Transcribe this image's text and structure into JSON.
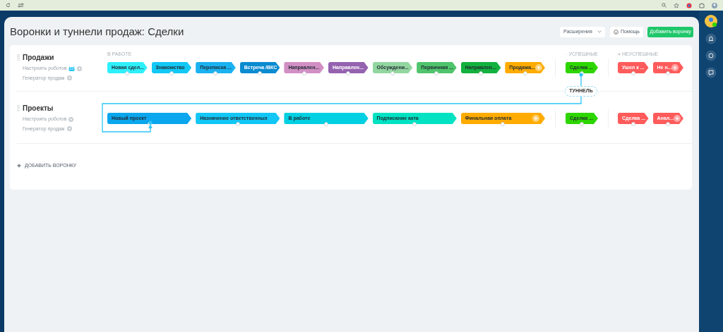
{
  "page_title": "Воронки и туннели продаж: Сделки",
  "header_buttons": {
    "extensions": "Расширения",
    "help": "Помощь",
    "add": "Добавить воронку"
  },
  "column_headers": {
    "in_work": "В РАБОТЕ",
    "success": "УСПЕШНЫЕ",
    "fail": "НЕУСПЕШНЫЕ"
  },
  "funnels": [
    {
      "name": "Продажи",
      "links": [
        {
          "label": "Настроить роботов",
          "robot_icon": true
        },
        {
          "label": "Генератор продаж",
          "robot_icon": false
        }
      ],
      "stages": [
        {
          "name": "Новая сдел...",
          "color": "#2ef0fa",
          "light_text": false,
          "add": false
        },
        {
          "name": "Знакомство",
          "color": "#12c8f5",
          "light_text": false,
          "add": false
        },
        {
          "name": "Переписка ...",
          "color": "#1ab2f0",
          "light_text": false,
          "add": false
        },
        {
          "name": "Встреча /ВКС",
          "color": "#0b8bd0",
          "light_text": true,
          "add": false
        },
        {
          "name": "Направлен...",
          "color": "#d18fc4",
          "light_text": false,
          "add": false
        },
        {
          "name": "Направлен...",
          "color": "#9562b0",
          "light_text": true,
          "add": false
        },
        {
          "name": "Обсуждени...",
          "color": "#93d6a0",
          "light_text": false,
          "add": false
        },
        {
          "name": "Первичная ...",
          "color": "#4fc46c",
          "light_text": false,
          "add": false
        },
        {
          "name": "Направлен...",
          "color": "#13b13e",
          "light_text": false,
          "add": false
        },
        {
          "name": "Продажа...",
          "color": "#ffab00",
          "light_text": false,
          "add": true
        }
      ],
      "success": [
        {
          "name": "Сделка ...",
          "color": "#2ed600",
          "light_text": false,
          "add": false
        }
      ],
      "fail": [
        {
          "name": "Ушел к ...",
          "color": "#ff5b5b",
          "light_text": true,
          "add": false
        },
        {
          "name": "Не н...",
          "color": "#ff5b5b",
          "light_text": true,
          "add": true
        }
      ]
    },
    {
      "name": "Проекты",
      "links": [
        {
          "label": "Настроить роботов",
          "robot_icon": false
        },
        {
          "label": "Генератор продаж",
          "robot_icon": false
        }
      ],
      "stages": [
        {
          "name": "Новый проект",
          "color": "#0aa6ee",
          "light_text": false,
          "add": false
        },
        {
          "name": "Назначение ответственных",
          "color": "#12c6f5",
          "light_text": false,
          "add": false
        },
        {
          "name": "В работе",
          "color": "#00d0e2",
          "light_text": false,
          "add": false
        },
        {
          "name": "Подписание акта",
          "color": "#00e2c2",
          "light_text": false,
          "add": false
        },
        {
          "name": "Финальная оплата",
          "color": "#ffab00",
          "light_text": false,
          "add": true
        }
      ],
      "success": [
        {
          "name": "Сделка ...",
          "color": "#2ed600",
          "light_text": false,
          "add": false
        }
      ],
      "fail": [
        {
          "name": "Сделка ...",
          "color": "#ff5b5b",
          "light_text": true,
          "add": false
        },
        {
          "name": "Анал...",
          "color": "#ff5b5b",
          "light_text": true,
          "add": true
        }
      ]
    }
  ],
  "tunnel": {
    "label": "ТУННЕЛЬ"
  },
  "add_funnel": "ДОБАВИТЬ ВОРОНКУ"
}
